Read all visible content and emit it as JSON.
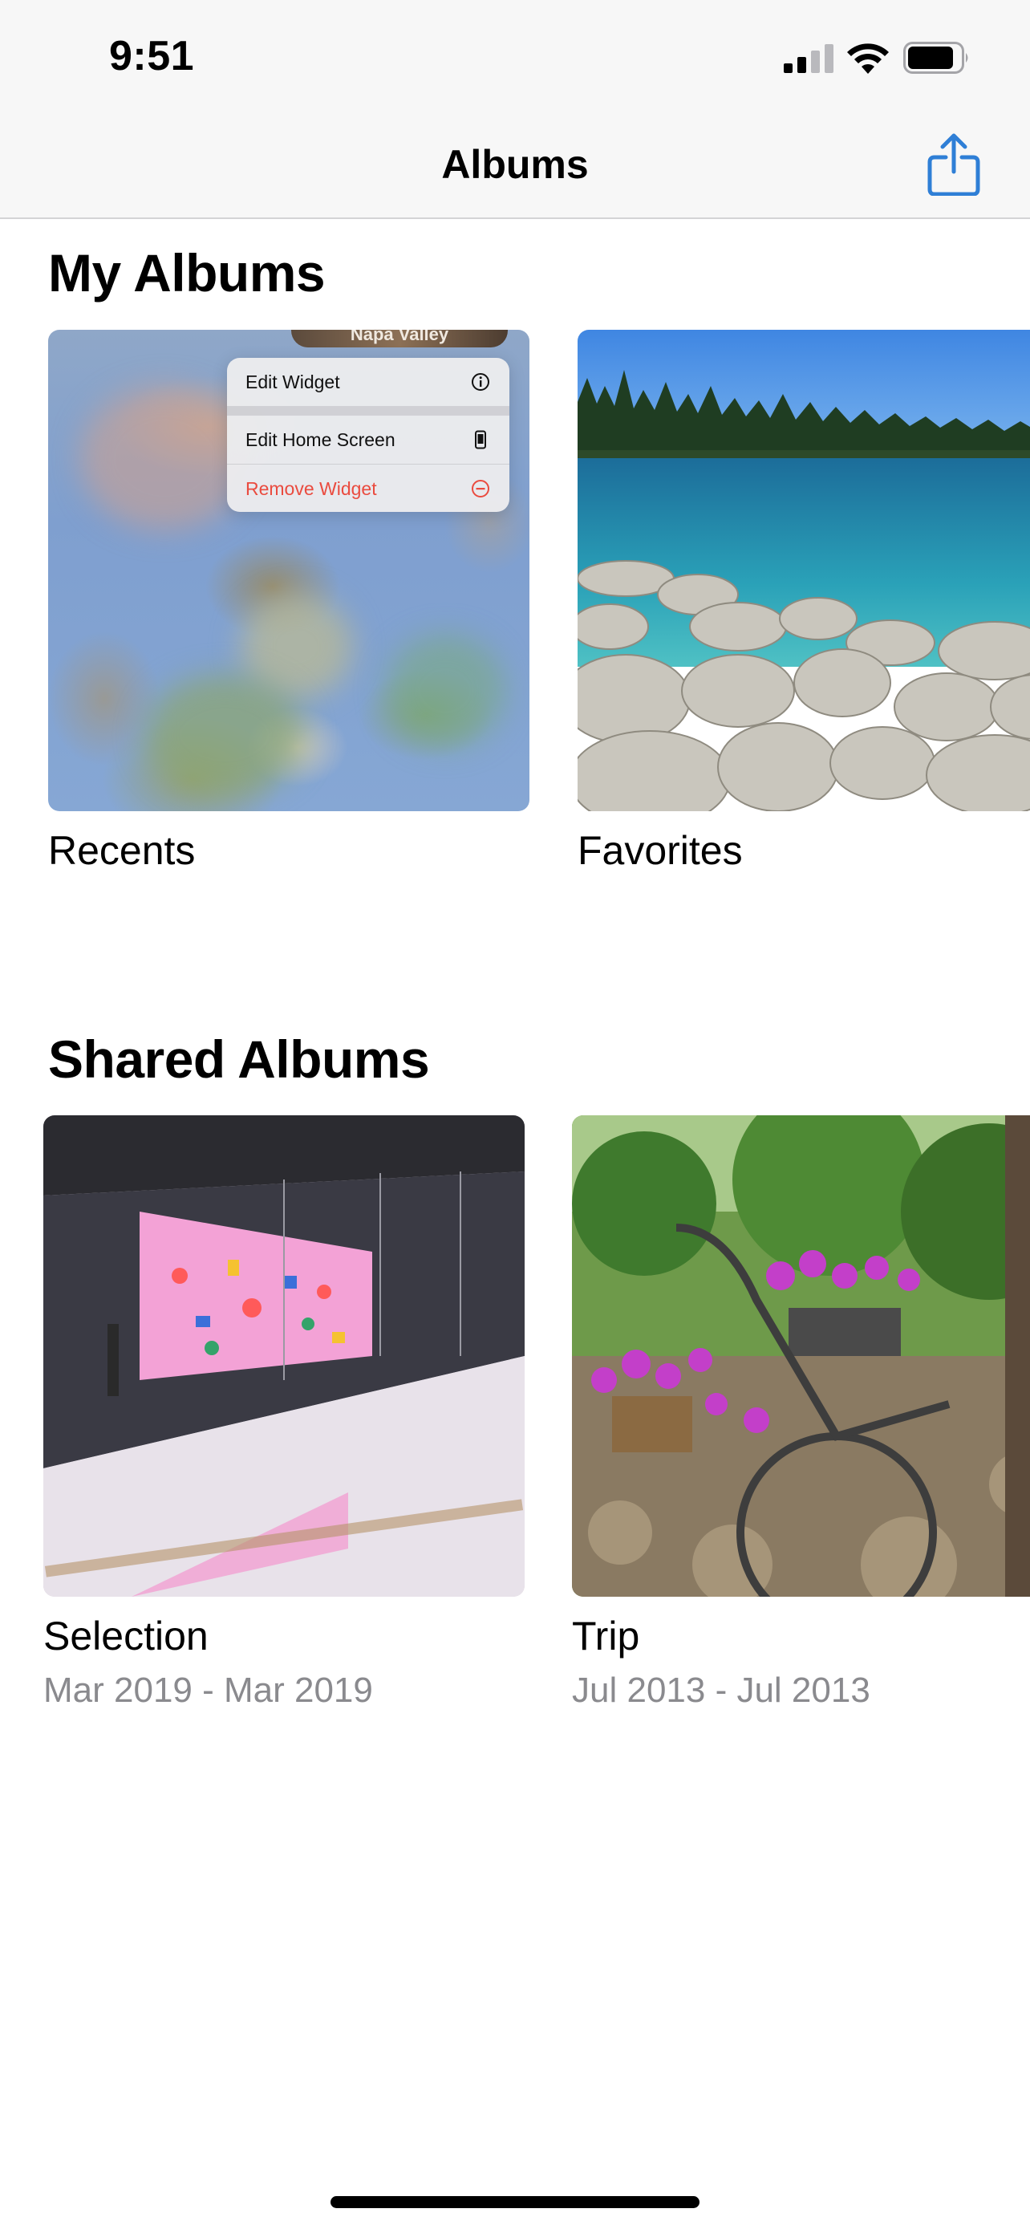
{
  "status_bar": {
    "time": "9:51"
  },
  "nav": {
    "title": "Albums"
  },
  "my_albums": {
    "title": "My Albums",
    "items": [
      {
        "name": "Recents",
        "overlay_label": "Napa Valley",
        "context_menu": [
          {
            "label": "Edit Widget",
            "icon": "info-circle-icon"
          },
          {
            "label": "Edit Home Screen",
            "icon": "phone-icon"
          },
          {
            "label": "Remove Widget",
            "icon": "minus-circle-icon"
          }
        ]
      },
      {
        "name": "Favorites"
      }
    ]
  },
  "shared_albums": {
    "title": "Shared Albums",
    "items": [
      {
        "name": "Selection",
        "dates": "Mar 2019 - Mar 2019"
      },
      {
        "name": "Trip",
        "dates": "Jul 2013 - Jul 2013"
      }
    ]
  },
  "colors": {
    "accent": "#2f7fd6",
    "destructive": "#ea4b3f",
    "secondary_text": "#8a8a8e"
  }
}
